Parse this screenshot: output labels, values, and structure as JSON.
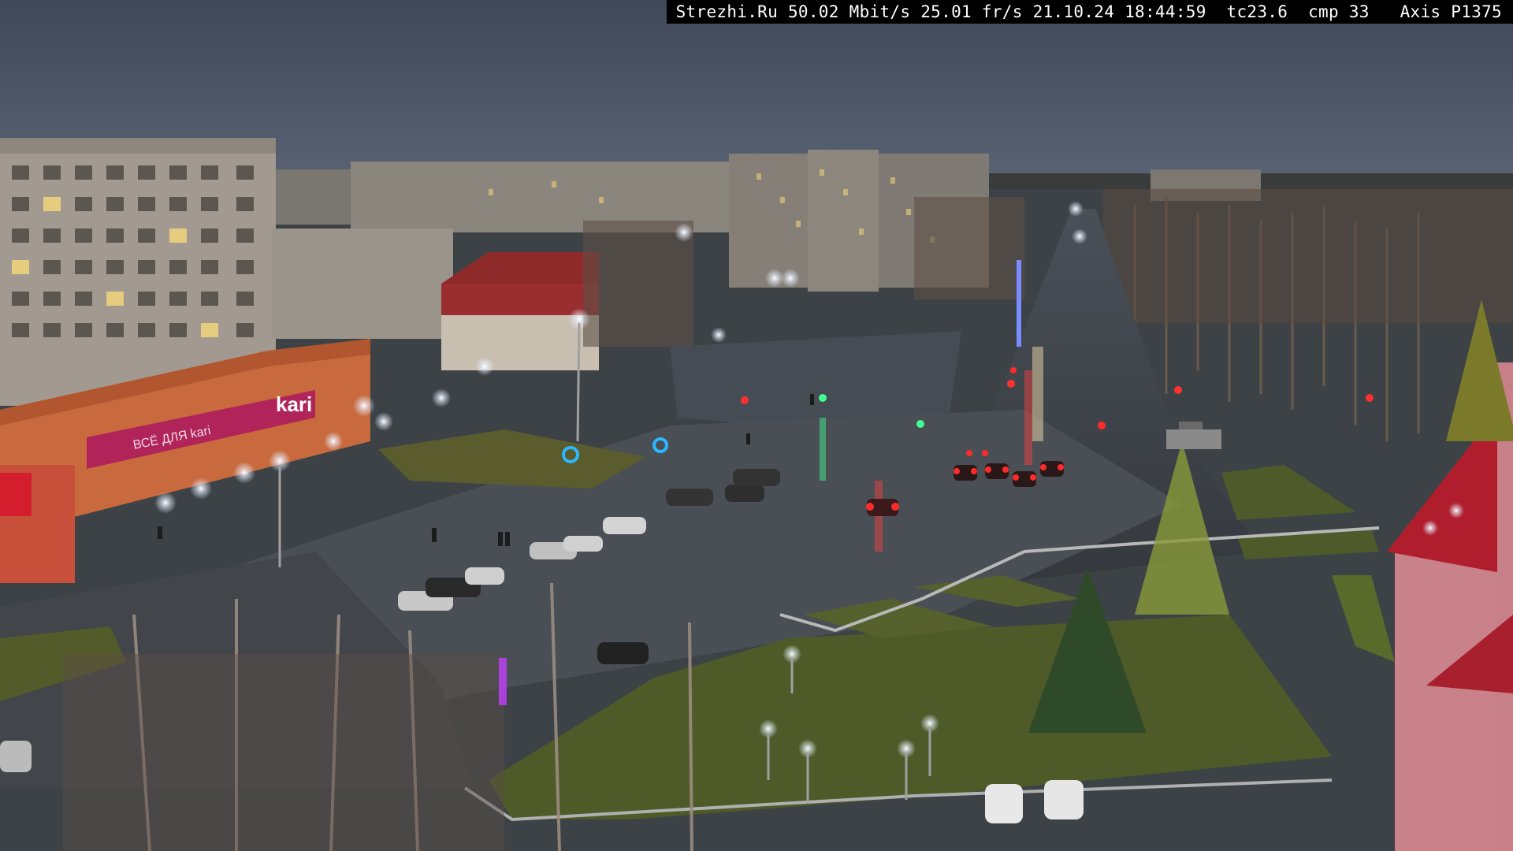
{
  "osd": {
    "text": "Strezhi.Ru 50.02 Mbit/s 25.01 fr/s 21.10.24 18:44:59  tc23.6  cmp 33   Axis P1375"
  },
  "signs": {
    "store_left": "kari",
    "store_banner": "ВСЁ ДЛЯ kari"
  },
  "colors": {
    "sky": "#4a5466",
    "asphalt": "#3e4348",
    "grass": "#4f5a2a",
    "light": "#f3f6ff",
    "taillight": "#ff2a2a",
    "magenta_sign": "#b0245a"
  }
}
